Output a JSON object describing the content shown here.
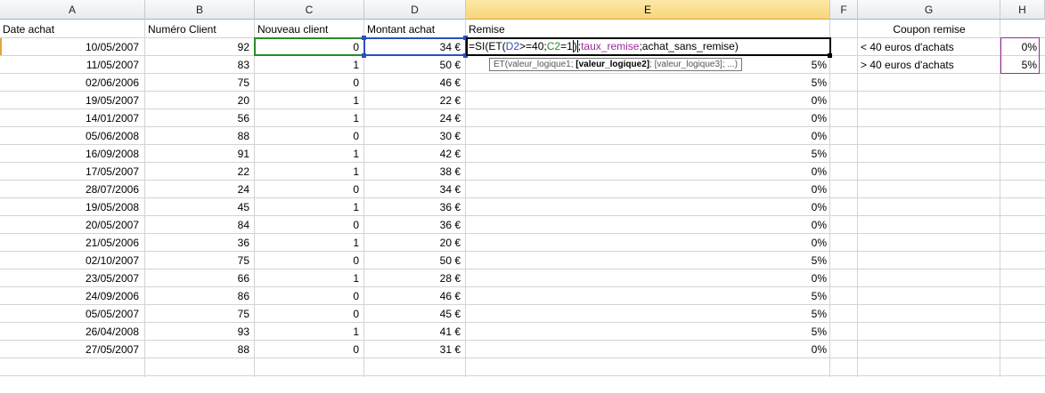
{
  "columns": [
    "A",
    "B",
    "C",
    "D",
    "E",
    "F",
    "G",
    "H"
  ],
  "headers": {
    "date": "Date achat",
    "client": "Numéro Client",
    "nouveau": "Nouveau client",
    "montant": "Montant achat",
    "remise": "Remise"
  },
  "formula": {
    "prefix": "=SI(ET(",
    "ref1": "D2",
    "mid": ">=40;",
    "ref2": "C2",
    "val": "=1",
    "close": ")",
    "sep": ";",
    "name1": "taux_remise",
    "tail": ";achat_sans_remise)"
  },
  "tooltip": {
    "fn": "ET(valeur_logique1; ",
    "bold": "[valeur_logique2]",
    "rest": "; [valeur_logique3]; ...)"
  },
  "coupon": {
    "title": "Coupon remise",
    "rows": [
      {
        "label": "< 40 euros d'achats",
        "value": "0%"
      },
      {
        "label": "> 40 euros d'achats",
        "value": "5%"
      }
    ]
  },
  "rows": [
    {
      "date": "10/05/2007",
      "client": "92",
      "nouveau": "0",
      "montant": "34 €",
      "remise": ""
    },
    {
      "date": "11/05/2007",
      "client": "83",
      "nouveau": "1",
      "montant": "50 €",
      "remise": "5%"
    },
    {
      "date": "02/06/2006",
      "client": "75",
      "nouveau": "0",
      "montant": "46 €",
      "remise": "5%"
    },
    {
      "date": "19/05/2007",
      "client": "20",
      "nouveau": "1",
      "montant": "22 €",
      "remise": "0%"
    },
    {
      "date": "14/01/2007",
      "client": "56",
      "nouveau": "1",
      "montant": "24 €",
      "remise": "0%"
    },
    {
      "date": "05/06/2008",
      "client": "88",
      "nouveau": "0",
      "montant": "30 €",
      "remise": "0%"
    },
    {
      "date": "16/09/2008",
      "client": "91",
      "nouveau": "1",
      "montant": "42 €",
      "remise": "5%"
    },
    {
      "date": "17/05/2007",
      "client": "22",
      "nouveau": "1",
      "montant": "38 €",
      "remise": "0%"
    },
    {
      "date": "28/07/2006",
      "client": "24",
      "nouveau": "0",
      "montant": "34 €",
      "remise": "0%"
    },
    {
      "date": "19/05/2008",
      "client": "45",
      "nouveau": "1",
      "montant": "36 €",
      "remise": "0%"
    },
    {
      "date": "20/05/2007",
      "client": "84",
      "nouveau": "0",
      "montant": "36 €",
      "remise": "0%"
    },
    {
      "date": "21/05/2006",
      "client": "36",
      "nouveau": "1",
      "montant": "20 €",
      "remise": "0%"
    },
    {
      "date": "02/10/2007",
      "client": "75",
      "nouveau": "0",
      "montant": "50 €",
      "remise": "5%"
    },
    {
      "date": "23/05/2007",
      "client": "66",
      "nouveau": "1",
      "montant": "28 €",
      "remise": "0%"
    },
    {
      "date": "24/09/2006",
      "client": "86",
      "nouveau": "0",
      "montant": "46 €",
      "remise": "5%"
    },
    {
      "date": "05/05/2007",
      "client": "75",
      "nouveau": "0",
      "montant": "45 €",
      "remise": "5%"
    },
    {
      "date": "26/04/2008",
      "client": "93",
      "nouveau": "1",
      "montant": "41 €",
      "remise": "5%"
    },
    {
      "date": "27/05/2007",
      "client": "88",
      "nouveau": "0",
      "montant": "31 €",
      "remise": "0%"
    }
  ],
  "colors": {
    "active_header": "#f7d57a",
    "ref_green": "#2a8a2a",
    "ref_blue": "#2b4fbf",
    "name_purple": "#9b2a9b"
  }
}
